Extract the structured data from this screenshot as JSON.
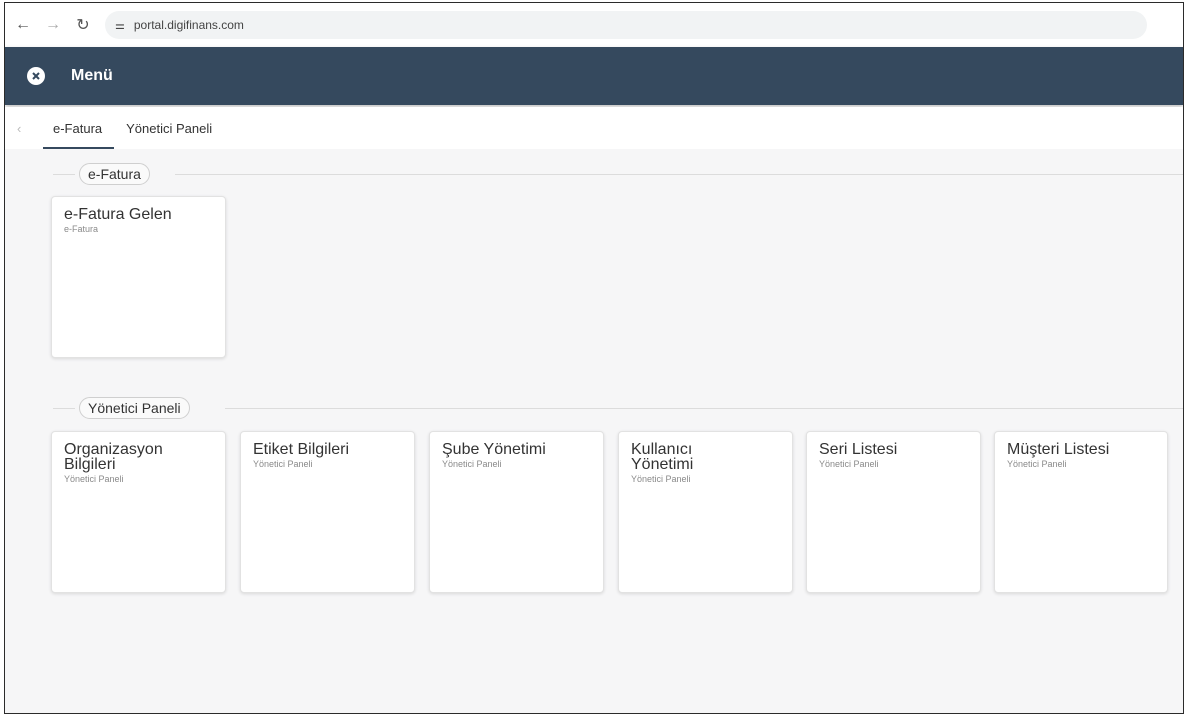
{
  "browser": {
    "url": "portal.digifinans.com",
    "back_icon": "arrow-left-icon",
    "forward_icon": "arrow-right-icon",
    "reload_icon": "reload-icon",
    "site_settings_icon": "tune-icon"
  },
  "header": {
    "title": "Menü",
    "close_icon": "close-circle-icon",
    "bg_color": "#35495e"
  },
  "tabs": [
    {
      "label": "e-Fatura",
      "active": true
    },
    {
      "label": "Yönetici Paneli",
      "active": false
    }
  ],
  "sections": [
    {
      "label": "e-Fatura",
      "cards": [
        {
          "title": "e-Fatura Gelen",
          "subtitle": "e-Fatura"
        }
      ]
    },
    {
      "label": "Yönetici Paneli",
      "cards": [
        {
          "title": "Organizasyon Bilgileri",
          "subtitle": "Yönetici Paneli"
        },
        {
          "title": "Etiket Bilgileri",
          "subtitle": "Yönetici Paneli"
        },
        {
          "title": "Şube Yönetimi",
          "subtitle": "Yönetici Paneli"
        },
        {
          "title": "Kullanıcı Yönetimi",
          "subtitle": "Yönetici Paneli"
        },
        {
          "title": "Seri Listesi",
          "subtitle": "Yönetici Paneli"
        },
        {
          "title": "Müşteri Listesi",
          "subtitle": "Yönetici Paneli"
        }
      ]
    }
  ]
}
